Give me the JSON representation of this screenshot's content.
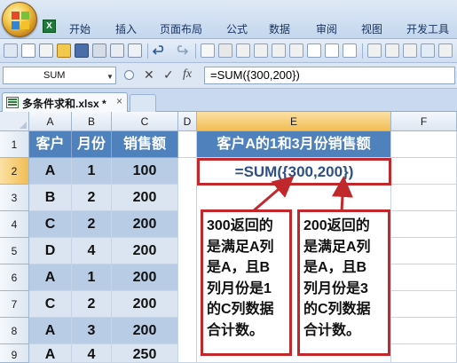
{
  "ribbon": {
    "tabs": [
      "开始",
      "插入",
      "页面布局",
      "公式",
      "数据",
      "审阅",
      "视图",
      "开发工具"
    ]
  },
  "formula_bar": {
    "name_box": "SUM",
    "cancel_symbol": "✕",
    "enter_symbol": "✓",
    "fx_label": "fx",
    "formula": "=SUM({300,200})"
  },
  "workbook_tab": {
    "filename": "多条件求和.xlsx *",
    "close_label": "×"
  },
  "grid": {
    "column_headers": [
      "A",
      "B",
      "C",
      "D",
      "E",
      "F"
    ],
    "row_headers": [
      "1",
      "2",
      "3",
      "4",
      "5",
      "6",
      "7",
      "8",
      "9"
    ],
    "table_headers": [
      "客户",
      "月份",
      "销售额"
    ],
    "rows": [
      [
        "A",
        "1",
        "100"
      ],
      [
        "B",
        "2",
        "200"
      ],
      [
        "C",
        "2",
        "200"
      ],
      [
        "D",
        "4",
        "200"
      ],
      [
        "A",
        "1",
        "200"
      ],
      [
        "C",
        "2",
        "200"
      ],
      [
        "A",
        "3",
        "200"
      ],
      [
        "A",
        "4",
        "250"
      ]
    ],
    "e1_title": "客户A的1和3月份销售额",
    "e2_formula": "=SUM({300,200})"
  },
  "callouts": {
    "left": [
      "300返回的",
      "是满足A列",
      "是A，且B",
      "列月份是1",
      "的C列数据",
      "合计数。"
    ],
    "right": [
      "200返回的",
      "是满足A列",
      "是A，且B",
      "列月份是3",
      "的C列数据",
      "合计数。"
    ]
  },
  "colors": {
    "table_header": "#4f81bd",
    "band_dark": "#b9cce6",
    "band_light": "#dbe5f1",
    "callout_border": "#c0282c",
    "formula_text": "#2f4f87"
  }
}
